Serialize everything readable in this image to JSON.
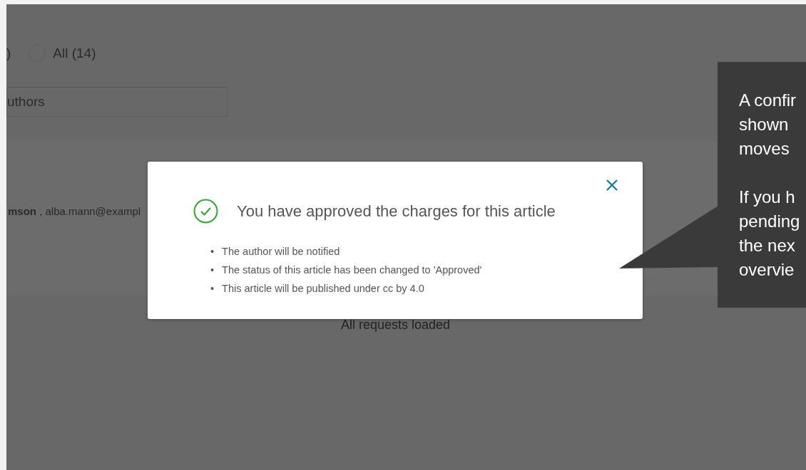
{
  "filters": {
    "cut_label": ")",
    "radio_options": [
      {
        "label": "All (14)",
        "selected": false
      }
    ]
  },
  "search": {
    "value": "uthors"
  },
  "request_row": {
    "authors": "**mson** , alba.mann@exampl"
  },
  "status": "All requests loaded",
  "dialog": {
    "title": "You have approved the charges for this article",
    "marker": "•",
    "items": [
      "The author will be notified",
      "The status of this article has been changed to 'Approved'",
      "This article will be published under cc by 4.0"
    ]
  },
  "callout": {
    "paragraphs": [
      [
        "A confir",
        "shown",
        "moves"
      ],
      [
        "If you h",
        "pending",
        "the nex",
        "overvie"
      ]
    ]
  }
}
